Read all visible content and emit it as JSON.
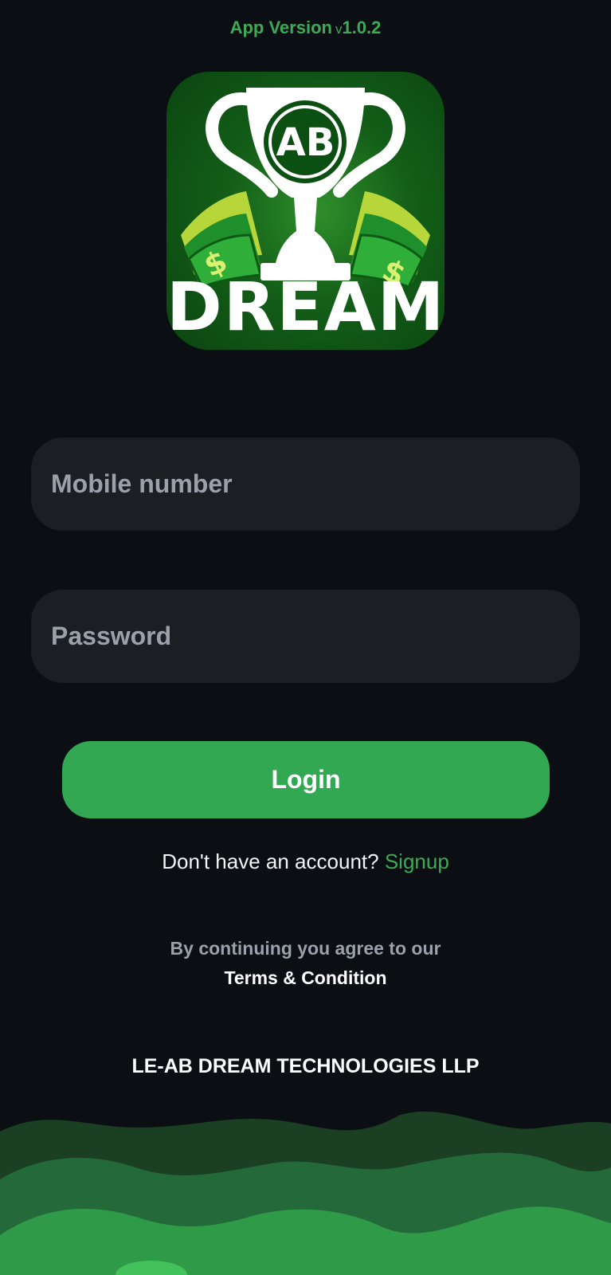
{
  "header": {
    "version_label": "App Version",
    "version_prefix": "v",
    "version_number": "1.0.2"
  },
  "logo": {
    "badge_text": "AB",
    "brand_text": "DREAM",
    "icon": "trophy-with-money-icon"
  },
  "form": {
    "mobile_placeholder": "Mobile number",
    "password_placeholder": "Password",
    "login_label": "Login"
  },
  "signup": {
    "prompt": "Don't have an account?",
    "link": "Signup"
  },
  "terms": {
    "line1": "By continuing you agree to our",
    "line2": "Terms & Condition"
  },
  "footer": {
    "company": "LE-AB DREAM TECHNOLOGIES LLP"
  },
  "colors": {
    "background": "#0b0f14",
    "accent": "#33a853",
    "field": "#1b1f24",
    "muted_text": "#9aa1aa"
  }
}
